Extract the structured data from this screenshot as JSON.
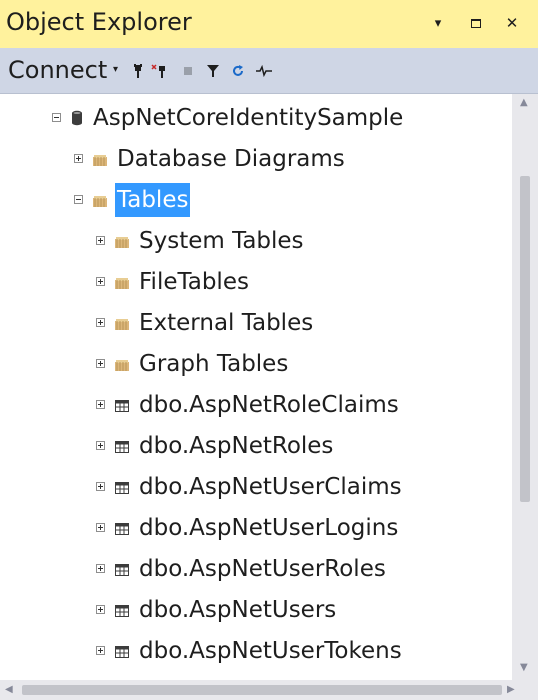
{
  "panel": {
    "title": "Object Explorer",
    "pin_icon": "pin-icon",
    "maximize_icon": "maximize-icon",
    "close_icon": "close-icon"
  },
  "toolbar": {
    "connect_label": "Connect",
    "connect_caret": "▾",
    "icons": [
      "connect-icon",
      "disconnect-icon",
      "stop-icon",
      "filter-icon",
      "refresh-icon",
      "activity-monitor-icon"
    ]
  },
  "tree": {
    "database": "AspNetCoreIdentitySample",
    "database_diagrams": "Database Diagrams",
    "tables": "Tables",
    "system_tables": "System Tables",
    "file_tables": "FileTables",
    "external_tables": "External Tables",
    "graph_tables": "Graph Tables",
    "table_items": [
      "dbo.AspNetRoleClaims",
      "dbo.AspNetRoles",
      "dbo.AspNetUserClaims",
      "dbo.AspNetUserLogins",
      "dbo.AspNetUserRoles",
      "dbo.AspNetUsers",
      "dbo.AspNetUserTokens"
    ]
  },
  "colors": {
    "title_bg": "#fff29d",
    "toolbar_bg": "#cfd6e5",
    "selection": "#3399ff",
    "folder": "#dcb67a"
  }
}
